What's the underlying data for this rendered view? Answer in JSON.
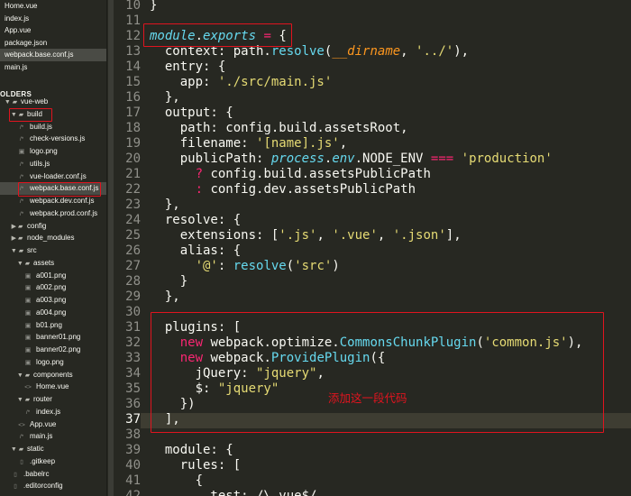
{
  "sidebar": {
    "open_files": [
      {
        "label": "Home.vue",
        "active": false
      },
      {
        "label": "index.js",
        "active": false
      },
      {
        "label": "App.vue",
        "active": false
      },
      {
        "label": "package.json",
        "active": false
      },
      {
        "label": "webpack.base.conf.js",
        "active": true
      },
      {
        "label": "main.js",
        "active": false
      }
    ],
    "folders_header": "OLDERS",
    "tree": [
      {
        "label": "vue-web",
        "icon": "folder-open-icon",
        "depth": 0
      },
      {
        "label": "build",
        "icon": "folder-open-icon",
        "depth": 1
      },
      {
        "label": "build.js",
        "icon": "js-file-icon",
        "depth": 2
      },
      {
        "label": "check-versions.js",
        "icon": "js-file-icon",
        "depth": 2
      },
      {
        "label": "logo.png",
        "icon": "image-file-icon",
        "depth": 2
      },
      {
        "label": "utils.js",
        "icon": "js-file-icon",
        "depth": 2
      },
      {
        "label": "vue-loader.conf.js",
        "icon": "js-file-icon",
        "depth": 2
      },
      {
        "label": "webpack.base.conf.js",
        "icon": "js-file-icon",
        "depth": 2,
        "active": true
      },
      {
        "label": "webpack.dev.conf.js",
        "icon": "js-file-icon",
        "depth": 2
      },
      {
        "label": "webpack.prod.conf.js",
        "icon": "js-file-icon",
        "depth": 2
      },
      {
        "label": "config",
        "icon": "folder-closed-icon",
        "depth": 1
      },
      {
        "label": "node_modules",
        "icon": "folder-closed-icon",
        "depth": 1
      },
      {
        "label": "src",
        "icon": "folder-open-icon",
        "depth": 1
      },
      {
        "label": "assets",
        "icon": "folder-open-icon",
        "depth": 2
      },
      {
        "label": "a001.png",
        "icon": "image-file-icon",
        "depth": 3
      },
      {
        "label": "a002.png",
        "icon": "image-file-icon",
        "depth": 3
      },
      {
        "label": "a003.png",
        "icon": "image-file-icon",
        "depth": 3
      },
      {
        "label": "a004.png",
        "icon": "image-file-icon",
        "depth": 3
      },
      {
        "label": "b01.png",
        "icon": "image-file-icon",
        "depth": 3
      },
      {
        "label": "banner01.png",
        "icon": "image-file-icon",
        "depth": 3
      },
      {
        "label": "banner02.png",
        "icon": "image-file-icon",
        "depth": 3
      },
      {
        "label": "logo.png",
        "icon": "image-file-icon",
        "depth": 3
      },
      {
        "label": "components",
        "icon": "folder-open-icon",
        "depth": 2
      },
      {
        "label": "Home.vue",
        "icon": "vue-file-icon",
        "depth": 3
      },
      {
        "label": "router",
        "icon": "folder-open-icon",
        "depth": 2
      },
      {
        "label": "index.js",
        "icon": "js-file-icon",
        "depth": 3
      },
      {
        "label": "App.vue",
        "icon": "vue-file-icon",
        "depth": 2
      },
      {
        "label": "main.js",
        "icon": "js-file-icon",
        "depth": 2
      },
      {
        "label": "static",
        "icon": "folder-open-icon",
        "depth": 1
      },
      {
        "label": ".gitkeep",
        "icon": "file-icon",
        "depth": 2
      },
      {
        "label": ".babelrc",
        "icon": "file-icon",
        "depth": 1
      },
      {
        "label": ".editorconfig",
        "icon": "file-icon",
        "depth": 1
      }
    ]
  },
  "editor": {
    "line_numbers": [
      "10",
      "11",
      "12",
      "13",
      "14",
      "15",
      "16",
      "17",
      "18",
      "19",
      "20",
      "21",
      "22",
      "23",
      "24",
      "25",
      "26",
      "27",
      "28",
      "29",
      "30",
      "31",
      "32",
      "33",
      "34",
      "35",
      "36",
      "37",
      "38",
      "39",
      "40",
      "41",
      "42"
    ],
    "current_line": "37"
  },
  "annotation_note": "添加这一段代码",
  "colors": {
    "background": "#272822",
    "annotation": "#e0141f",
    "keyword": "#66d9ef",
    "string": "#e6db74",
    "operator": "#f92672"
  }
}
